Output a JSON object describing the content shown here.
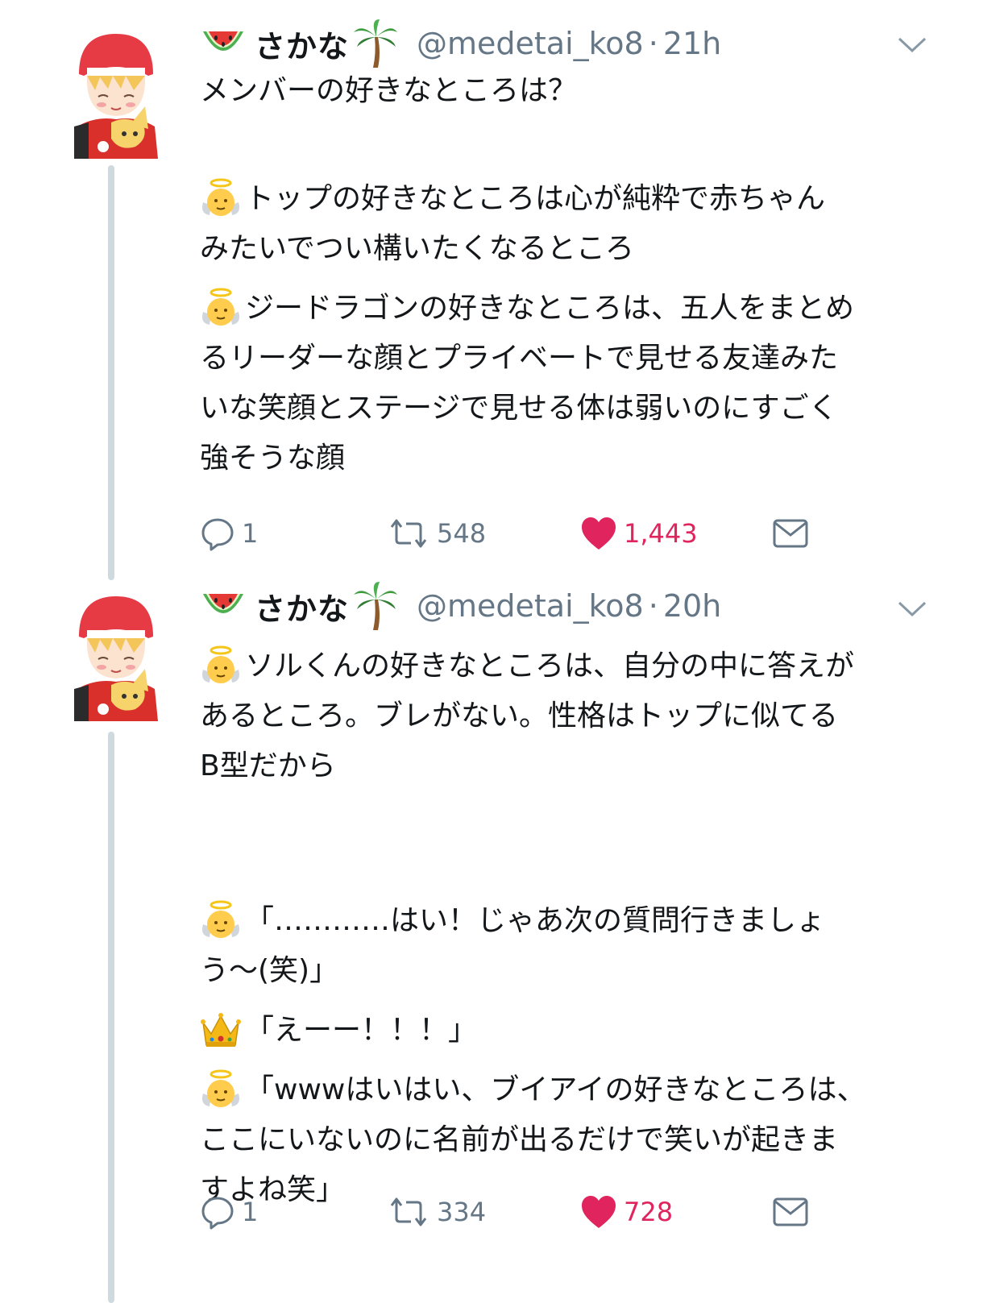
{
  "colors": {
    "text": "#14171a",
    "secondary": "#657786",
    "like": "#e0245e",
    "thread_line": "#cfd9de"
  },
  "tweets": [
    {
      "name": "さかな",
      "handle": "@medetai_ko8",
      "separator": "·",
      "time": "21h",
      "lines": [
        {
          "icon": "",
          "text": "メンバーの好きなところは？"
        },
        {
          "icon": "",
          "text": ""
        },
        {
          "icon": "",
          "text": ""
        },
        {
          "icon": "baby-angel-icon",
          "text": "トップの好きなところは心が純粋で赤ちゃん"
        },
        {
          "icon": "",
          "text": "みたいでつい構いたくなるところ"
        },
        {
          "icon": "",
          "text": ""
        },
        {
          "icon": "baby-angel-icon",
          "text": "ジードラゴンの好きなところは、五人をまとめ"
        },
        {
          "icon": "",
          "text": "るリーダーな顔とプライベートで見せる友達みた"
        },
        {
          "icon": "",
          "text": "いな笑顔とステージで見せる体は弱いのにすごく"
        },
        {
          "icon": "",
          "text": "強そうな顔"
        }
      ],
      "replies": "1",
      "retweets": "548",
      "likes": "1,443"
    },
    {
      "name": "さかな",
      "handle": "@medetai_ko8",
      "separator": "·",
      "time": "20h",
      "lines": [
        {
          "icon": "baby-angel-icon",
          "text": "ソルくんの好きなところは、自分の中に答えが"
        },
        {
          "icon": "",
          "text": "あるところ。ブレがない。性格はトップに似てる"
        },
        {
          "icon": "",
          "text": "B型だから"
        },
        {
          "icon": "",
          "text": ""
        },
        {
          "icon": "",
          "text": ""
        },
        {
          "icon": "baby-angel-icon",
          "text": "「…………はい！じゃあ次の質問行きましょ"
        },
        {
          "icon": "",
          "text": "う～(笑)」"
        },
        {
          "icon": "",
          "text": ""
        },
        {
          "icon": "crown-icon",
          "text": "「えーー！！！」"
        },
        {
          "icon": "",
          "text": ""
        },
        {
          "icon": "baby-angel-icon",
          "text": "「wwwはいはい、ブイアイの好きなところは、"
        },
        {
          "icon": "",
          "text": "ここにいないのに名前が出るだけで笑いが起きま"
        },
        {
          "icon": "",
          "text": "すよね笑」"
        }
      ],
      "replies": "1",
      "retweets": "334",
      "likes": "728"
    }
  ]
}
